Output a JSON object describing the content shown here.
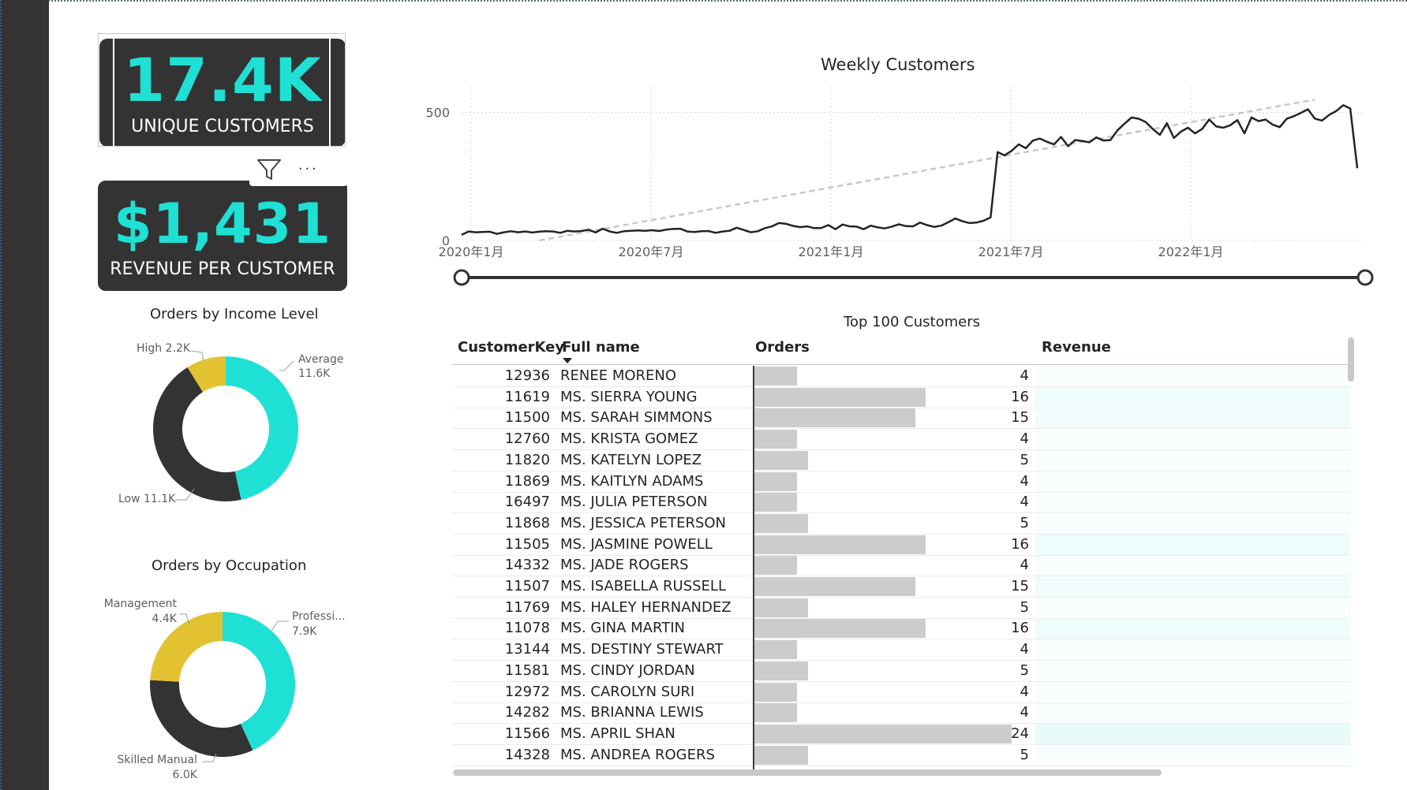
{
  "kpis": {
    "unique_customers": {
      "value": "17.4K",
      "label": "UNIQUE CUSTOMERS"
    },
    "revenue_per_customer": {
      "value": "$1,431",
      "label": "REVENUE PER CUSTOMER"
    }
  },
  "visual_header": {
    "filter_icon": "filter-icon",
    "more_icon": "more-options-icon",
    "more_label": "..."
  },
  "income_donut": {
    "title": "Orders by Income Level",
    "slices": [
      {
        "name": "Average",
        "value": "11.6K",
        "color": "#1fe0d4",
        "amount": 11.6
      },
      {
        "name": "Low",
        "value": "11.1K",
        "color": "#333333",
        "amount": 11.1
      },
      {
        "name": "High",
        "value": "2.2K",
        "color": "#e3c232",
        "amount": 2.2
      }
    ],
    "labels": {
      "average_name": "Average",
      "average_value": "11.6K",
      "low": "Low 11.1K",
      "high": "High 2.2K"
    }
  },
  "occupation_donut": {
    "title": "Orders by Occupation",
    "slices": [
      {
        "name": "Professi...",
        "value": "7.9K",
        "color": "#1fe0d4",
        "amount": 7.9
      },
      {
        "name": "Skilled Manual",
        "value": "6.0K",
        "color": "#333333",
        "amount": 6.0
      },
      {
        "name": "Management",
        "value": "4.4K",
        "color": "#e3c232",
        "amount": 4.4
      }
    ]
  },
  "chart_data": {
    "type": "line",
    "title": "Weekly Customers",
    "xlabel": "",
    "ylabel": "",
    "x_ticks": [
      "2020年1月",
      "2020年7月",
      "2021年1月",
      "2021年7月",
      "2022年1月"
    ],
    "y_ticks": [
      "0",
      "500"
    ],
    "ylim": [
      0,
      600
    ],
    "grid": true,
    "series": [
      {
        "values": [
          22,
          35,
          32,
          33,
          34,
          26,
          32,
          36,
          32,
          35,
          31,
          34,
          36,
          35,
          30,
          38,
          35,
          37,
          42,
          31,
          46,
          35,
          30,
          36,
          38,
          39,
          38,
          40,
          37,
          42,
          45,
          46,
          35,
          33,
          36,
          37,
          30,
          35,
          38,
          50,
          41,
          32,
          36,
          48,
          55,
          68,
          65,
          57,
          52,
          55,
          48,
          49,
          60,
          44,
          62,
          55,
          54,
          44,
          58,
          51,
          47,
          54,
          63,
          56,
          55,
          70,
          60,
          53,
          58,
          71,
          86,
          75,
          68,
          70,
          77,
          90,
          345,
          332,
          350,
          375,
          360,
          390,
          398,
          385,
          375,
          404,
          368,
          392,
          388,
          383,
          402,
          390,
          392,
          430,
          456,
          480,
          475,
          462,
          435,
          412,
          458,
          400,
          425,
          440,
          418,
          435,
          472,
          445,
          440,
          450,
          470,
          418,
          480,
          466,
          472,
          452,
          442,
          475,
          485,
          498,
          512,
          475,
          468,
          490,
          505,
          528,
          515,
          282
        ]
      },
      {
        "name": "trend",
        "values": [
          -55,
          -50,
          -45,
          -40,
          -35,
          -30,
          -25,
          -20,
          -15,
          -10,
          -5,
          0,
          5,
          10,
          15,
          20,
          25,
          30,
          35,
          40,
          45,
          50,
          55,
          60,
          65,
          70,
          75,
          80,
          85,
          90,
          95,
          100,
          105,
          110,
          115,
          120,
          125,
          130,
          135,
          140,
          145,
          150,
          155,
          160,
          165,
          170,
          175,
          180,
          185,
          190,
          195,
          200,
          205,
          210,
          215,
          220,
          225,
          230,
          235,
          240,
          245,
          250,
          255,
          260,
          265,
          270,
          275,
          280,
          285,
          290,
          295,
          300,
          305,
          310,
          315,
          320,
          325,
          330,
          335,
          340,
          345,
          350,
          355,
          360,
          365,
          370,
          375,
          380,
          385,
          390,
          395,
          400,
          405,
          410,
          415,
          420,
          425,
          430,
          435,
          440,
          445,
          450,
          455,
          460,
          465,
          470,
          475,
          480,
          485,
          490,
          495,
          500,
          505,
          510,
          515,
          520,
          525,
          530,
          535,
          540,
          545,
          550
        ]
      }
    ]
  },
  "slider": {
    "start": 0,
    "end": 1
  },
  "table": {
    "title": "Top 100 Customers",
    "headers": {
      "key": "CustomerKey",
      "name": "Full name",
      "orders": "Orders",
      "revenue": "Revenue"
    },
    "rows": [
      {
        "key": "12936",
        "name": "RENEE MORENO",
        "orders": "4",
        "orders_n": 4
      },
      {
        "key": "11619",
        "name": "MS. SIERRA YOUNG",
        "orders": "16",
        "orders_n": 16
      },
      {
        "key": "11500",
        "name": "MS. SARAH SIMMONS",
        "orders": "15",
        "orders_n": 15
      },
      {
        "key": "12760",
        "name": "MS. KRISTA GOMEZ",
        "orders": "4",
        "orders_n": 4
      },
      {
        "key": "11820",
        "name": "MS. KATELYN LOPEZ",
        "orders": "5",
        "orders_n": 5
      },
      {
        "key": "11869",
        "name": "MS. KAITLYN ADAMS",
        "orders": "4",
        "orders_n": 4
      },
      {
        "key": "16497",
        "name": "MS. JULIA PETERSON",
        "orders": "4",
        "orders_n": 4
      },
      {
        "key": "11868",
        "name": "MS. JESSICA PETERSON",
        "orders": "5",
        "orders_n": 5
      },
      {
        "key": "11505",
        "name": "MS. JASMINE POWELL",
        "orders": "16",
        "orders_n": 16
      },
      {
        "key": "14332",
        "name": "MS. JADE ROGERS",
        "orders": "4",
        "orders_n": 4
      },
      {
        "key": "11507",
        "name": "MS. ISABELLA RUSSELL",
        "orders": "15",
        "orders_n": 15
      },
      {
        "key": "11769",
        "name": "MS. HALEY HERNANDEZ",
        "orders": "5",
        "orders_n": 5
      },
      {
        "key": "11078",
        "name": "MS. GINA MARTIN",
        "orders": "16",
        "orders_n": 16
      },
      {
        "key": "13144",
        "name": "MS. DESTINY STEWART",
        "orders": "4",
        "orders_n": 4
      },
      {
        "key": "11581",
        "name": "MS. CINDY JORDAN",
        "orders": "5",
        "orders_n": 5
      },
      {
        "key": "12972",
        "name": "MS. CAROLYN SURI",
        "orders": "4",
        "orders_n": 4
      },
      {
        "key": "14282",
        "name": "MS. BRIANNA LEWIS",
        "orders": "4",
        "orders_n": 4
      },
      {
        "key": "11566",
        "name": "MS. APRIL SHAN",
        "orders": "24",
        "orders_n": 24
      },
      {
        "key": "14328",
        "name": "MS. ANDREA ROGERS",
        "orders": "5",
        "orders_n": 5
      }
    ]
  },
  "colors": {
    "accent": "#1fe0d4",
    "dark": "#333333",
    "yellow": "#e3c232",
    "bar": "#cccccc",
    "revenue_bg": "#e8fbf9"
  }
}
